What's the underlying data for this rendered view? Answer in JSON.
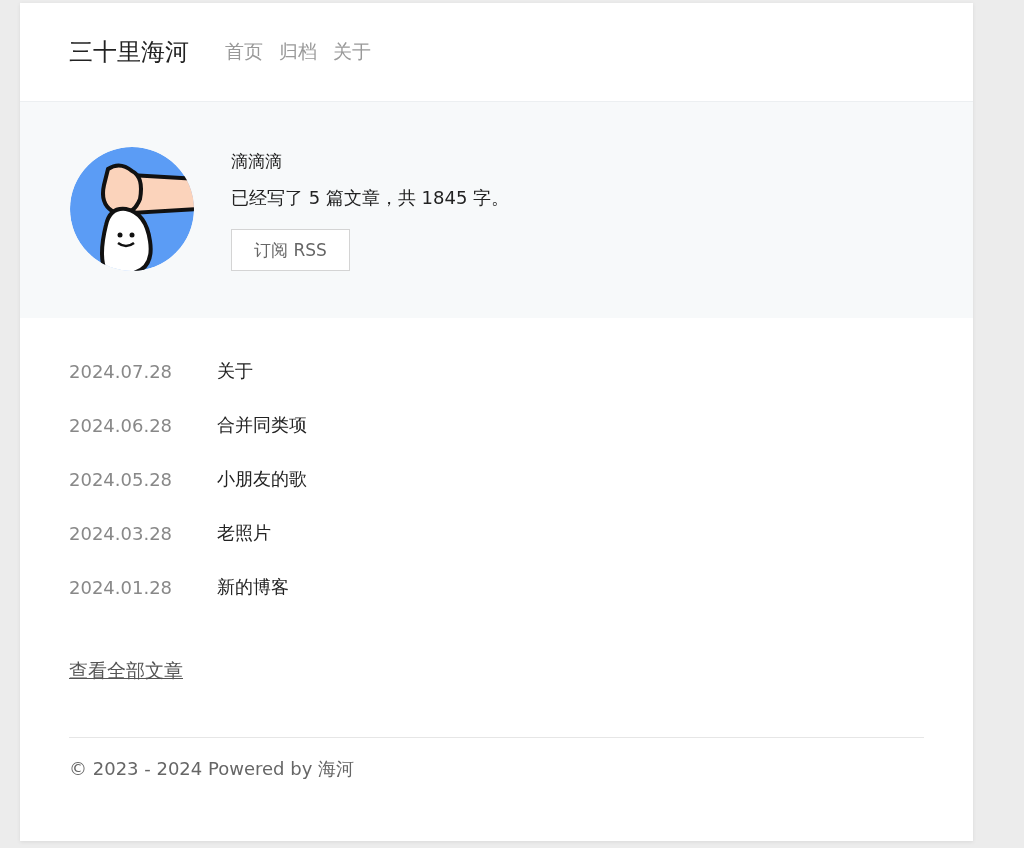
{
  "site_title": "三十里海河",
  "nav": [
    {
      "label": "首页"
    },
    {
      "label": "归档"
    },
    {
      "label": "关于"
    }
  ],
  "profile": {
    "name": "滴滴滴",
    "summary": "已经写了 5 篇文章，共 1845 字。",
    "button": "订阅 RSS"
  },
  "posts": [
    {
      "date": "2024.07.28",
      "title": "关于"
    },
    {
      "date": "2024.06.28",
      "title": "合并同类项"
    },
    {
      "date": "2024.05.28",
      "title": "小朋友的歌"
    },
    {
      "date": "2024.03.28",
      "title": "老照片"
    },
    {
      "date": "2024.01.28",
      "title": "新的博客"
    }
  ],
  "all_posts_link": "查看全部文章",
  "footer": "© 2023 - 2024 Powered by 海河"
}
